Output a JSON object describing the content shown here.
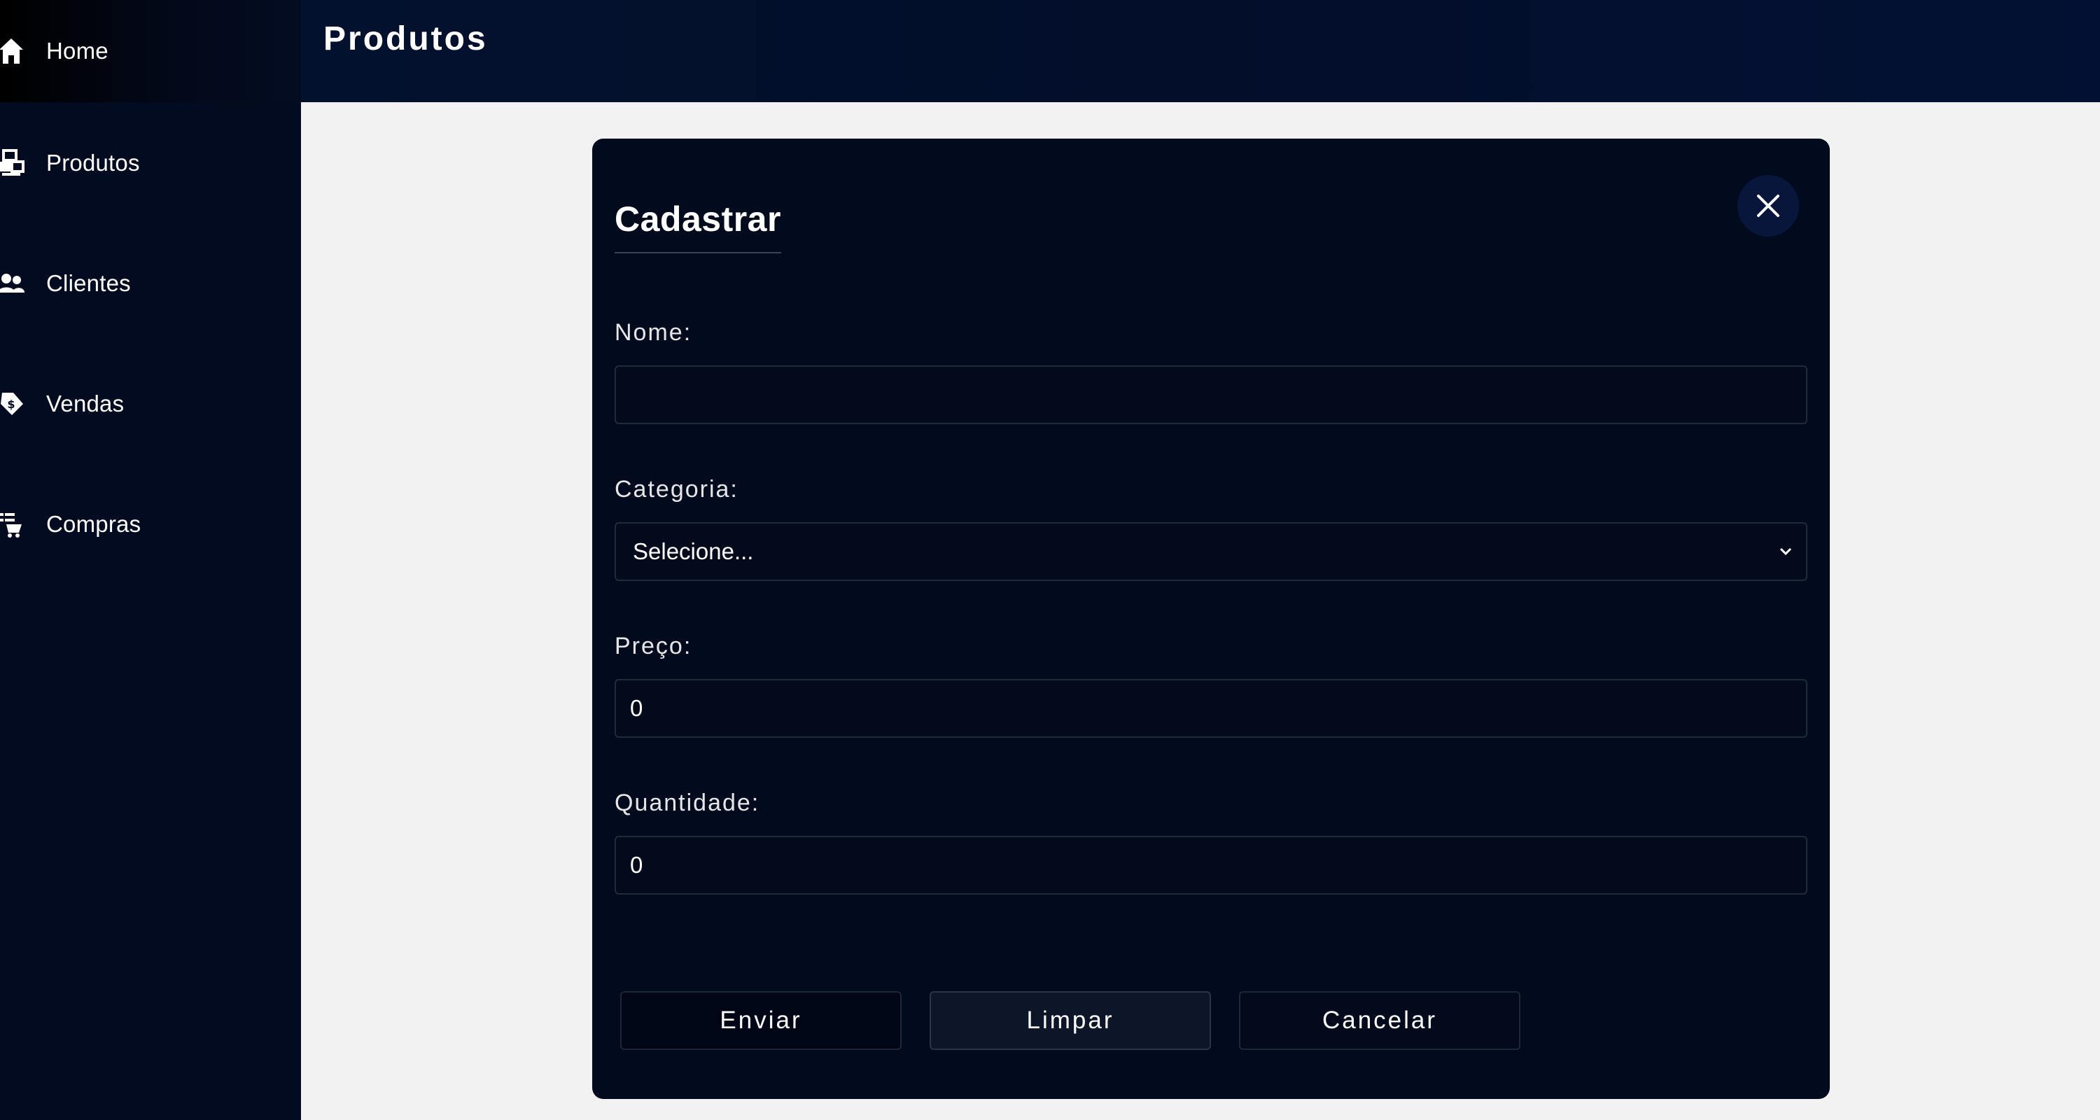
{
  "sidebar": {
    "items": [
      {
        "label": "Home",
        "icon": "home-icon"
      },
      {
        "label": "Produtos",
        "icon": "boxes-icon"
      },
      {
        "label": "Clientes",
        "icon": "users-icon"
      },
      {
        "label": "Vendas",
        "icon": "sales-tag-icon"
      },
      {
        "label": "Compras",
        "icon": "cart-list-icon"
      }
    ]
  },
  "header": {
    "title": "Produtos"
  },
  "modal": {
    "title": "Cadastrar",
    "close_icon": "close-icon",
    "fields": {
      "nome": {
        "label": "Nome:",
        "value": ""
      },
      "categoria": {
        "label": "Categoria:",
        "value": "Selecione..."
      },
      "preco": {
        "label": "Preço:",
        "value": "0"
      },
      "quantidade": {
        "label": "Quantidade:",
        "value": "0"
      }
    },
    "buttons": {
      "enviar": "Enviar",
      "limpar": "Limpar",
      "cancelar": "Cancelar"
    }
  },
  "colors": {
    "sidebar_bg": "#020b1f",
    "header_bg": "#02112e",
    "modal_bg": "#020b1e",
    "page_bg": "#f2f2f2",
    "text": "#ffffff"
  }
}
